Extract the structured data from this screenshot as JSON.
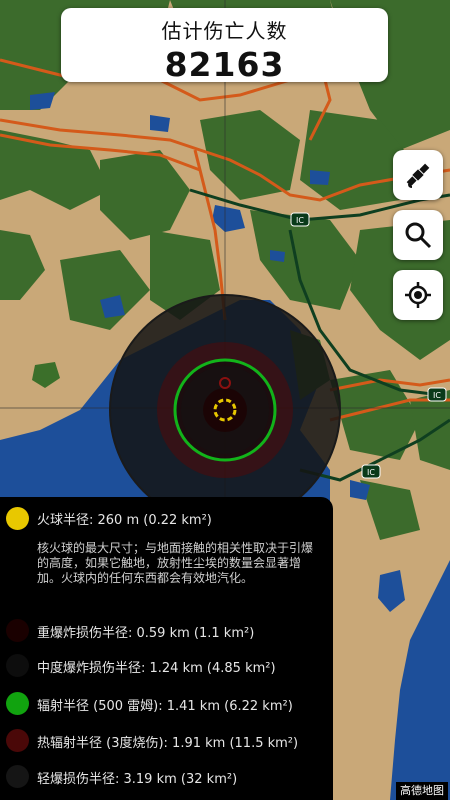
{
  "header": {
    "title": "估计伤亡人数",
    "value": "82163"
  },
  "icons": {
    "satellite": "satellite-icon",
    "search": "search-icon",
    "locate": "crosshair-locate-icon"
  },
  "map": {
    "road_shields": [
      "IC",
      "IC",
      "IC"
    ]
  },
  "legend": {
    "fireball": {
      "color": "#e8c800",
      "label": "火球半径: 260 m (0.22 km²)",
      "description": "核火球的最大尺寸；与地面接触的相关性取决于引爆的高度，如果它触地，放射性尘埃的数量会显著增加。火球内的任何东西都会有效地汽化。"
    },
    "items": [
      {
        "color": "#1a0000",
        "label": "重爆炸损伤半径: 0.59 km (1.1 km²)"
      },
      {
        "color": "#0d0d0d",
        "label": "中度爆炸损伤半径: 1.24 km (4.85 km²)"
      },
      {
        "color": "#11a30f",
        "label": "辐射半径 (500 雷姆): 1.41 km (6.22 km²)"
      },
      {
        "color": "#4a0808",
        "label": "热辐射半径 (3度烧伤): 1.91 km (11.5 km²)"
      },
      {
        "color": "#151515",
        "label": "轻爆损伤半径: 3.19 km (32 km²)"
      }
    ]
  },
  "footer_badge": "高德地图"
}
